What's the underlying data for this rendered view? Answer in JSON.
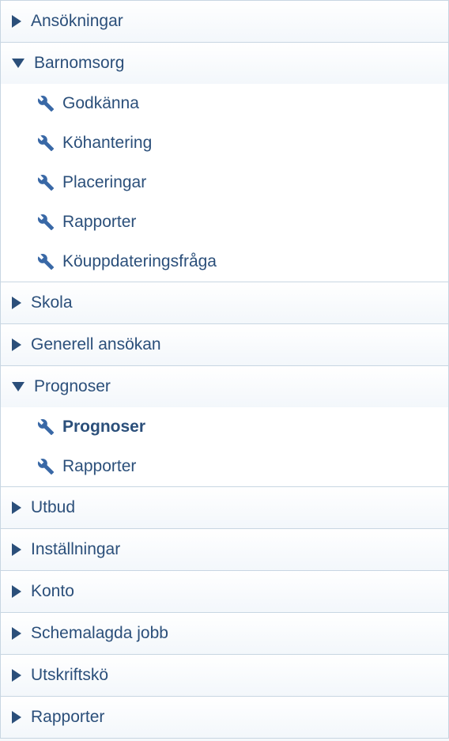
{
  "nav": {
    "items": [
      {
        "label": "Ansökningar",
        "expanded": false,
        "children": []
      },
      {
        "label": "Barnomsorg",
        "expanded": true,
        "children": [
          {
            "label": "Godkänna",
            "selected": false
          },
          {
            "label": "Köhantering",
            "selected": false
          },
          {
            "label": "Placeringar",
            "selected": false
          },
          {
            "label": "Rapporter",
            "selected": false
          },
          {
            "label": "Köuppdateringsfråga",
            "selected": false
          }
        ]
      },
      {
        "label": "Skola",
        "expanded": false,
        "children": []
      },
      {
        "label": "Generell ansökan",
        "expanded": false,
        "children": []
      },
      {
        "label": "Prognoser",
        "expanded": true,
        "children": [
          {
            "label": "Prognoser",
            "selected": true
          },
          {
            "label": "Rapporter",
            "selected": false
          }
        ]
      },
      {
        "label": "Utbud",
        "expanded": false,
        "children": []
      },
      {
        "label": "Inställningar",
        "expanded": false,
        "children": []
      },
      {
        "label": "Konto",
        "expanded": false,
        "children": []
      },
      {
        "label": "Schemalagda jobb",
        "expanded": false,
        "children": []
      },
      {
        "label": "Utskriftskö",
        "expanded": false,
        "children": []
      },
      {
        "label": "Rapporter",
        "expanded": false,
        "children": []
      }
    ]
  },
  "colors": {
    "text": "#2b4f7a",
    "border": "#c8d6e2",
    "wrench": "#3968a6"
  }
}
